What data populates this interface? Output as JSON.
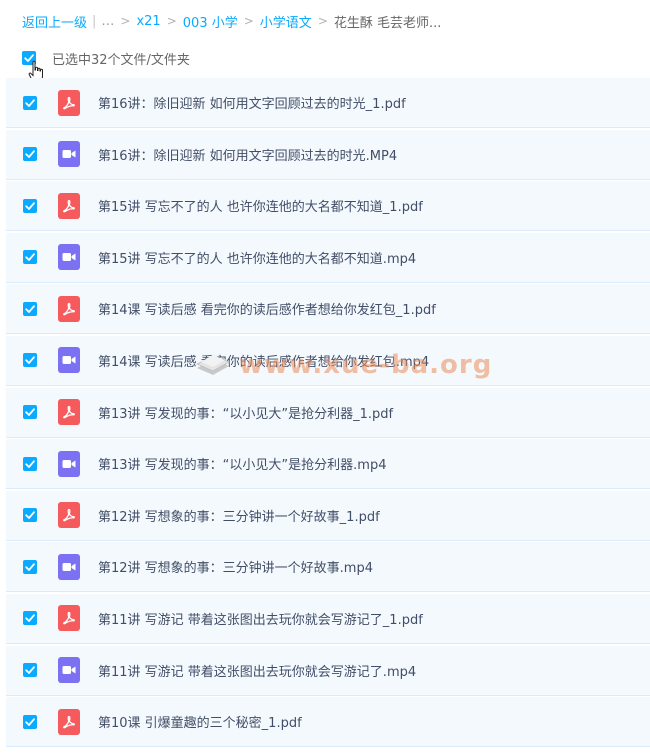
{
  "breadcrumb": {
    "back": "返回上一级",
    "ellipsis": "…",
    "items": [
      "x21",
      "003 小学",
      "小学语文"
    ],
    "current": "花生酥 毛芸老师..."
  },
  "selection": {
    "label": "已选中32个文件/文件夹",
    "all_checked": true
  },
  "files": [
    {
      "name": "第16讲：除旧迎新 如何用文字回顾过去的时光_1.pdf",
      "type": "pdf",
      "checked": true
    },
    {
      "name": "第16讲：除旧迎新 如何用文字回顾过去的时光.MP4",
      "type": "video",
      "checked": true
    },
    {
      "name": "第15讲 写忘不了的人 也许你连他的大名都不知道_1.pdf",
      "type": "pdf",
      "checked": true
    },
    {
      "name": "第15讲 写忘不了的人 也许你连他的大名都不知道.mp4",
      "type": "video",
      "checked": true
    },
    {
      "name": "第14课 写读后感 看完你的读后感作者想给你发红包_1.pdf",
      "type": "pdf",
      "checked": true
    },
    {
      "name": "第14课 写读后感 看完你的读后感作者想给你发红包.mp4",
      "type": "video",
      "checked": true
    },
    {
      "name": "第13讲 写发现的事：“以小见大”是抢分利器_1.pdf",
      "type": "pdf",
      "checked": true
    },
    {
      "name": "第13讲 写发现的事：“以小见大”是抢分利器.mp4",
      "type": "video",
      "checked": true
    },
    {
      "name": "第12讲 写想象的事：三分钟讲一个好故事_1.pdf",
      "type": "pdf",
      "checked": true
    },
    {
      "name": "第12讲 写想象的事：三分钟讲一个好故事.mp4",
      "type": "video",
      "checked": true
    },
    {
      "name": "第11讲 写游记 带着这张图出去玩你就会写游记了_1.pdf",
      "type": "pdf",
      "checked": true
    },
    {
      "name": "第11讲 写游记 带着这张图出去玩你就会写游记了.mp4",
      "type": "video",
      "checked": true
    },
    {
      "name": "第10课 引爆童趣的三个秘密_1.pdf",
      "type": "pdf",
      "checked": true
    }
  ],
  "watermark": {
    "text": "www.xue-ba.org",
    "icon": "book-stack-icon"
  },
  "colors": {
    "accent": "#09aaff",
    "pdf": "#f55b5d",
    "video": "#7b71f2",
    "row_bg": "#f4f9fe",
    "row_border": "#dcebfb",
    "text": "#424e67"
  }
}
